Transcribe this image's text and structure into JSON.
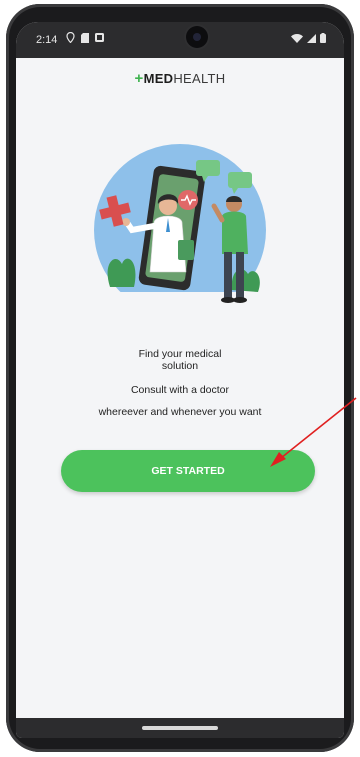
{
  "status_bar": {
    "time": "2:14",
    "left_icons": [
      "location-icon",
      "sim-card-icon",
      "notification-icon"
    ],
    "right_icons": [
      "wifi-icon",
      "signal-icon",
      "battery-icon"
    ]
  },
  "brand": {
    "plus": "+",
    "bold": "MED",
    "light": "HEALTH",
    "accent_color": "#3fb34f"
  },
  "hero": {
    "icon": "telemedicine-illustration"
  },
  "tagline": "Find your medical solution",
  "subtitle_line1": "Consult with a doctor",
  "subtitle_line2": "whereever and whenever you want",
  "cta": {
    "label": "GET STARTED",
    "color": "#4cc25c"
  },
  "annotation": {
    "arrow_color": "#e02020"
  }
}
